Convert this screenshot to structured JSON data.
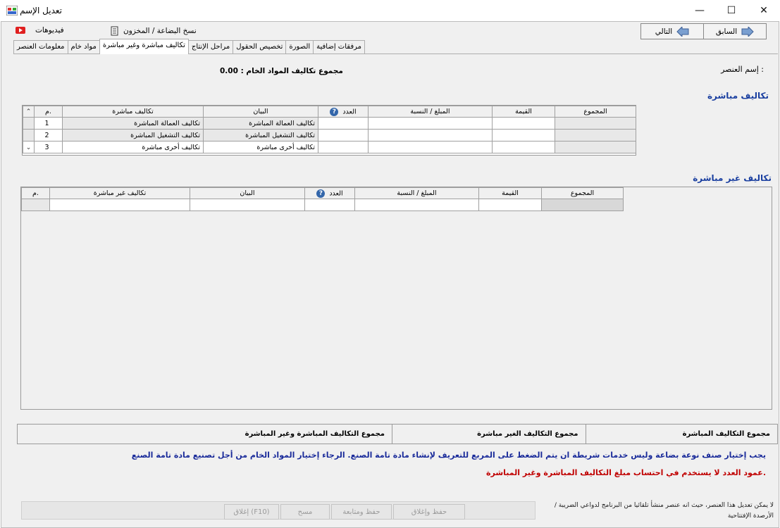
{
  "window": {
    "title": "تعديل الإسم",
    "minimize": "—",
    "maximize": "☐",
    "close": "✕"
  },
  "toolbar": {
    "videos": "فيديوهات",
    "copy_item": "نسخ البضاعة / المخزون",
    "prev": "السابق",
    "next": "التالي"
  },
  "tabs": [
    "معلومات العنصر",
    "مواد خام",
    "تكاليف مباشرة وغير مباشرة",
    "مراحل الإنتاج",
    "تخصيص الحقول",
    "الصورة",
    "مرفقات إضافية"
  ],
  "active_tab": "تكاليف مباشرة وغير مباشرة",
  "form": {
    "item_name_label": "إسم العنصر :",
    "raw_total_label": "مجموع تكاليف المواد الخام : 0.00"
  },
  "direct": {
    "title": "تكاليف مباشرة",
    "columns": [
      "م.",
      "تكاليف مباشرة",
      "البيان",
      "العدد",
      "المبلغ / النسبة",
      "القيمة",
      "المجموع"
    ],
    "rows": [
      {
        "no": "1",
        "cost": "تكاليف العمالة المباشرة",
        "desc": "تكاليف العمالة المباشرة",
        "count": "",
        "amount": "",
        "value": "",
        "total": ""
      },
      {
        "no": "2",
        "cost": "تكاليف التشغيل المباشرة",
        "desc": "تكاليف التشغيل المباشرة",
        "count": "",
        "amount": "",
        "value": "",
        "total": ""
      },
      {
        "no": "3",
        "cost": "تكاليف أخرى مباشرة",
        "desc": "تكاليف أخرى مباشرة",
        "count": "",
        "amount": "",
        "value": "",
        "total": ""
      }
    ]
  },
  "indirect": {
    "title": "تكاليف غير مباشرة",
    "columns": [
      "م.",
      "تكاليف غير مباشرة",
      "البيان",
      "العدد",
      "المبلغ / النسبة",
      "القيمة",
      "المجموع"
    ]
  },
  "totals": {
    "direct": "مجموع التكاليف المباشرة",
    "indirect": "مجموع التكاليف الغير مباشرة",
    "all": "مجموع التكاليف المباشرة وغير المباشرة"
  },
  "messages": {
    "blue": "يجب إختيار صنف نوعة بضاعة وليس خدمات شريطة ان يتم الضغط على المربع للتعريف لإنشاء مادة تامة الصنع. الرجاء إختيار المواد الخام من أجل تصنيع مادة تامة الصنع",
    "red": "عمود العدد لا يستخدم في احتساب مبلغ التكاليف المباشرة وغير المباشرة."
  },
  "buttons": {
    "save_close": "حفظ وإغلاق",
    "save_continue": "حفظ ومتابعة",
    "clear": "مسح",
    "close": "إغلاق (F10)"
  },
  "footnote": "لا يمكن تعديل هذا العنصر، حيث انه عنصر منشأ تلقائيا من البرنامج لدواعي الضريبة / الأرصدة الإفتتاحية",
  "colors": {
    "section_title": "#1a3fa0",
    "message_blue": "#1a2b9a",
    "message_red": "#c00000"
  }
}
